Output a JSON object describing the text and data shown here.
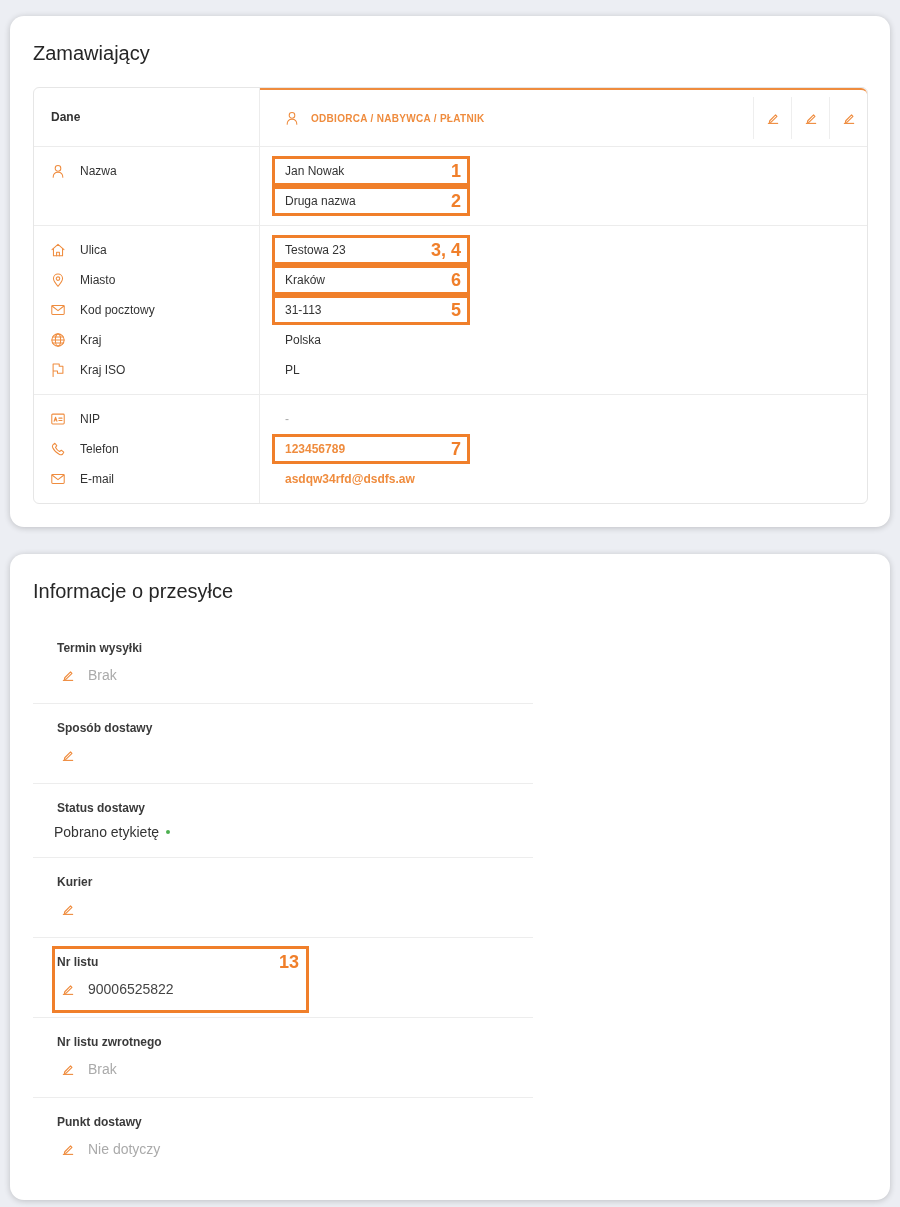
{
  "customer": {
    "title": "Zamawiający",
    "table": {
      "header_label": "Dane",
      "tabs": [
        {
          "label": "ODBIORCA / NABYWCA / PŁATNIK",
          "selected": true
        }
      ],
      "groups": [
        {
          "rows": [
            {
              "kind": "name",
              "label": "Nazwa",
              "values": [
                {
                  "text": "Jan Nowak",
                  "empty": false,
                  "callout": "1"
                },
                {
                  "text": "Druga nazwa",
                  "empty": false,
                  "callout": "2"
                }
              ]
            }
          ]
        },
        {
          "rows": [
            {
              "kind": "street",
              "label": "Ulica",
              "values": [
                {
                  "text": "Testowa 23",
                  "empty": false,
                  "callout": "3, 4"
                }
              ]
            },
            {
              "kind": "city",
              "label": "Miasto",
              "values": [
                {
                  "text": "Kraków",
                  "empty": false,
                  "callout": "6"
                }
              ]
            },
            {
              "kind": "postcode",
              "label": "Kod pocztowy",
              "values": [
                {
                  "text": "31-113",
                  "empty": false,
                  "callout": "5"
                }
              ]
            },
            {
              "kind": "country",
              "label": "Kraj",
              "values": [
                {
                  "text": "Polska",
                  "empty": false
                }
              ]
            },
            {
              "kind": "country_code",
              "label": "Kraj ISO",
              "values": [
                {
                  "text": "PL",
                  "empty": false
                }
              ]
            }
          ]
        },
        {
          "rows": [
            {
              "kind": "tax_id",
              "label": "NIP",
              "values": [
                {
                  "text": "-",
                  "empty": true
                }
              ]
            },
            {
              "kind": "phone",
              "label": "Telefon",
              "values": [
                {
                  "text": "123456789",
                  "empty": false,
                  "callout": "7"
                }
              ]
            },
            {
              "kind": "email",
              "label": "E-mail",
              "values": [
                {
                  "text": "asdqw34rfd@dsdfs.aw",
                  "empty": false
                }
              ]
            }
          ]
        }
      ]
    }
  },
  "shipment": {
    "title": "Informacje o przesyłce",
    "fields": [
      {
        "kind": "editable",
        "label": "Termin wysyłki",
        "value": {
          "text": "Brak",
          "empty": true
        }
      },
      {
        "kind": "editable",
        "label": "Sposób dostawy"
      },
      {
        "kind": "status",
        "label": "Status dostawy",
        "value": {
          "text": "Pobrano etykietę",
          "empty": false
        },
        "color": "#4caf50"
      },
      {
        "kind": "editable",
        "label": "Kurier"
      },
      {
        "kind": "editable",
        "label": "Nr listu",
        "value": {
          "text": "90006525822",
          "empty": false
        },
        "callout": "13"
      },
      {
        "kind": "editable",
        "label": "Nr listu zwrotnego",
        "value": {
          "text": "Brak",
          "empty": true
        }
      },
      {
        "kind": "editable",
        "label": "Punkt dostawy",
        "value": {
          "text": "Nie dotyczy",
          "empty": true
        }
      }
    ]
  }
}
